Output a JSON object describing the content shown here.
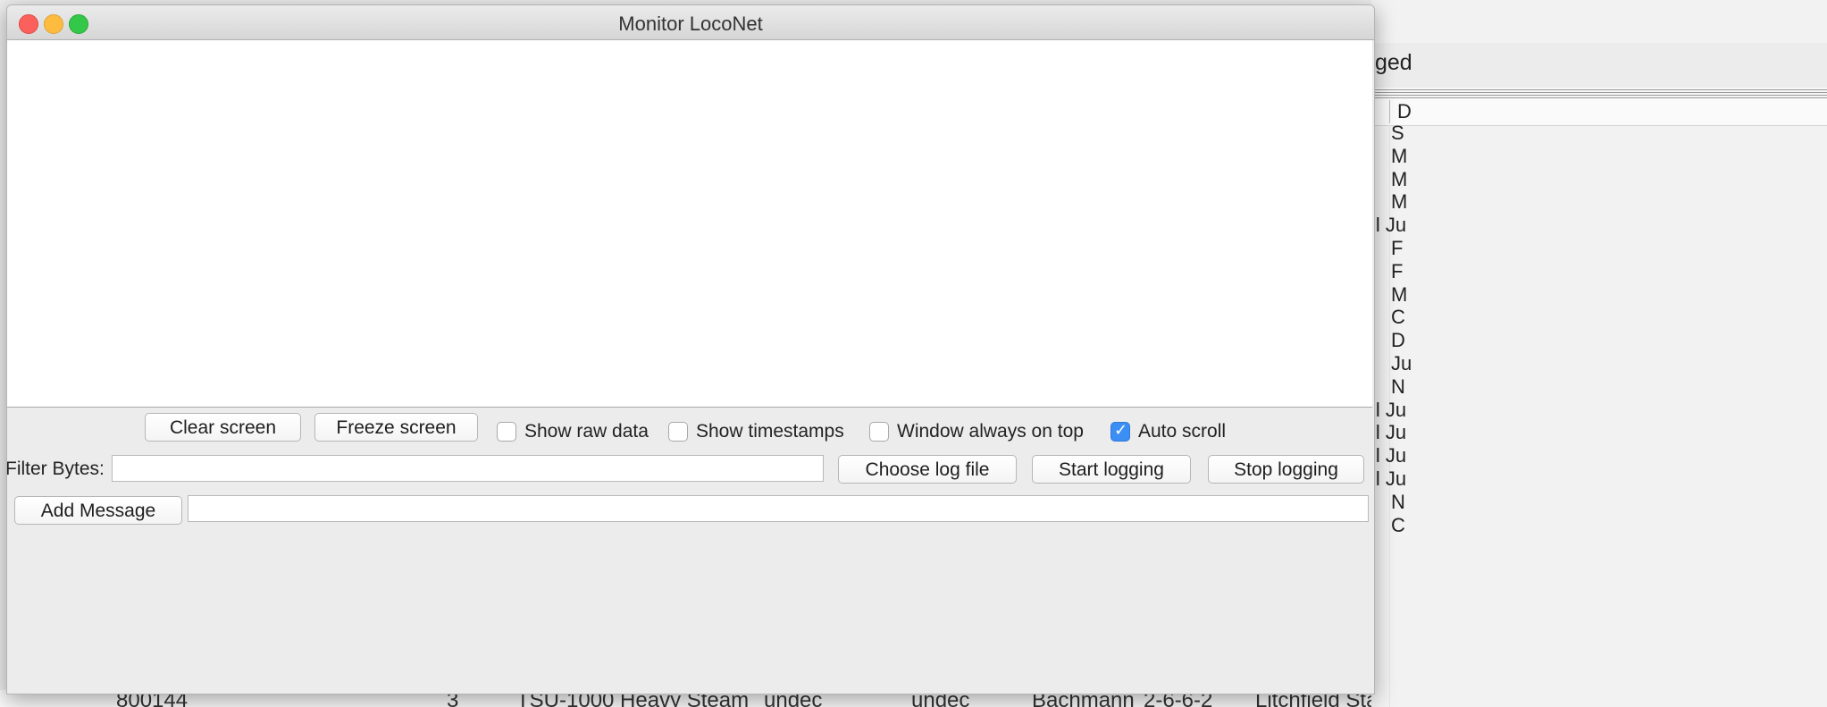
{
  "window": {
    "title": "Monitor LocoNet"
  },
  "buttons": {
    "clear_screen": "Clear screen",
    "freeze_screen": "Freeze screen",
    "choose_log_file": "Choose log file",
    "start_logging": "Start logging",
    "stop_logging": "Stop logging",
    "add_message": "Add Message"
  },
  "checkboxes": {
    "show_raw_data": {
      "label": "Show raw data",
      "checked": false
    },
    "show_timestamps": {
      "label": "Show timestamps",
      "checked": false
    },
    "window_always_on_top": {
      "label": "Window always on top",
      "checked": false
    },
    "auto_scroll": {
      "label": "Auto scroll",
      "checked": true
    }
  },
  "filter": {
    "label": "Filter Bytes:",
    "value": ""
  },
  "add_message_input": {
    "value": ""
  },
  "background": {
    "toolbar_text": "ged",
    "header_text": "D",
    "rows": [
      "S",
      "M",
      "M",
      "M",
      "ll Ju",
      "F",
      "F",
      "M",
      "C",
      "D",
      "Ju",
      "N",
      "ll Ju",
      "ll Ju",
      "ll Ju",
      "ll Ju",
      "N",
      "C"
    ],
    "bottom_row": [
      "800144",
      "3",
      "TSU-1000 Heavy Steam",
      "undec",
      "undec",
      "Bachmann",
      "2-6-6-2",
      "Litchfield Station Ju"
    ]
  },
  "colors": {
    "checkbox_checked": "#3b8ef3",
    "close": "#fc605c",
    "minimize": "#fdbc40",
    "zoom": "#34c84a"
  }
}
